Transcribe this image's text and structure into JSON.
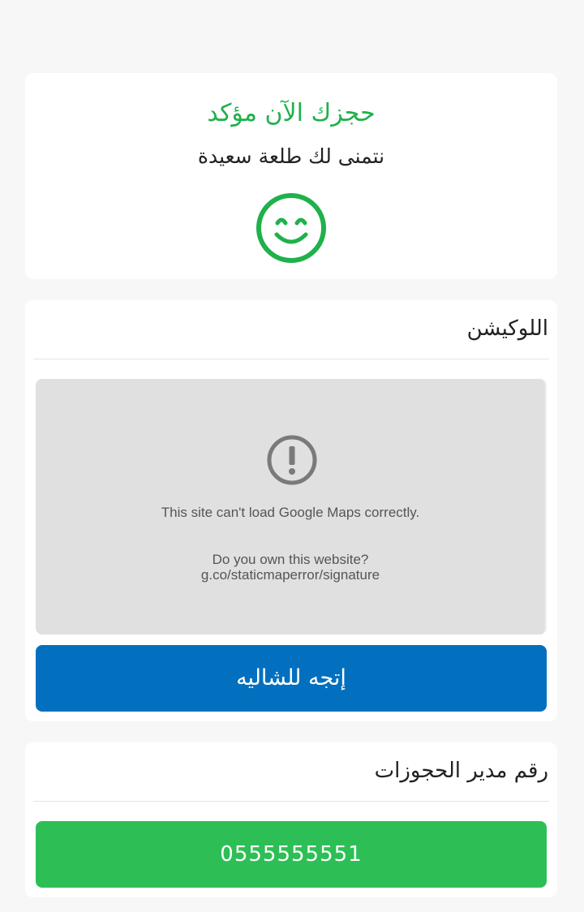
{
  "confirmation": {
    "title": "حجزك الآن مؤكد",
    "subtitle": "نتمنى لك طلعة سعيدة",
    "icon": "smiley-face-icon",
    "accent_color": "#1fb14b"
  },
  "location": {
    "title": "اللوكيشن",
    "map_error_icon": "exclamation-circle-icon",
    "map_error": "This site can't load Google Maps correctly.",
    "map_question": "Do you own this website?",
    "map_link": "g.co/staticmaperror/signature",
    "directions_button": "إتجه للشاليه",
    "button_color": "#0370bf"
  },
  "manager": {
    "title": "رقم مدير الحجوزات",
    "phone": "0555555551",
    "button_color": "#2dbf55"
  }
}
